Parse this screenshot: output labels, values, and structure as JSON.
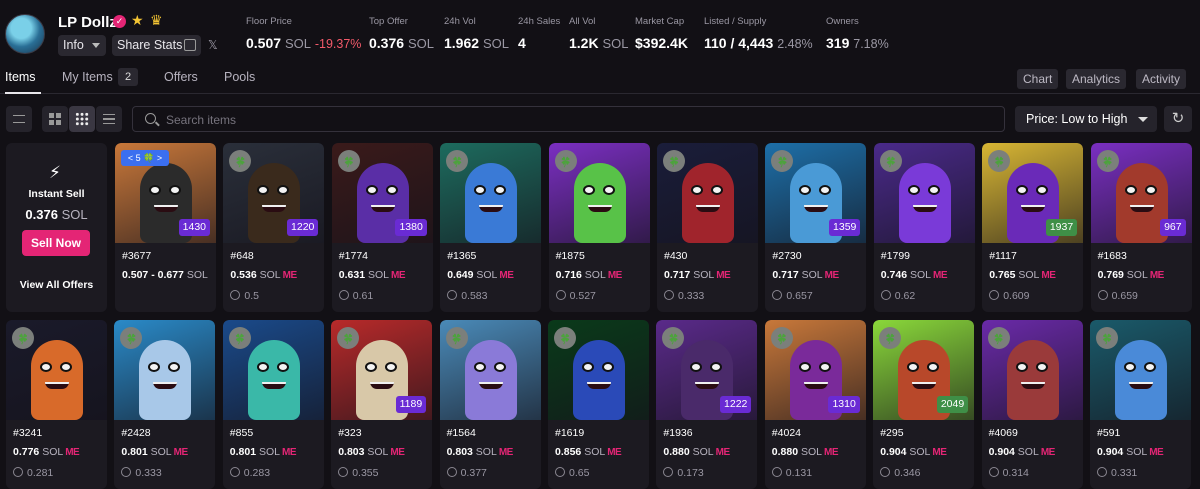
{
  "collection": {
    "name": "LP Dollz",
    "info_label": "Info",
    "share_label": "Share Stats",
    "x_label": "𝕏"
  },
  "stats": [
    {
      "label": "Floor Price",
      "value": "0.507",
      "unit": "SOL",
      "change": "-19.37%"
    },
    {
      "label": "Top Offer",
      "value": "0.376",
      "unit": "SOL"
    },
    {
      "label": "24h Vol",
      "value": "1.962",
      "unit": "SOL"
    },
    {
      "label": "24h Sales",
      "value": "4"
    },
    {
      "label": "All Vol",
      "value": "1.2K",
      "unit": "SOL"
    },
    {
      "label": "Market Cap",
      "value": "$392.4K"
    },
    {
      "label": "Listed / Supply",
      "value": "110 / 4,443",
      "pct": "2.48%"
    },
    {
      "label": "Owners",
      "value": "319",
      "pct": "7.18%"
    }
  ],
  "tabs": {
    "items": "Items",
    "my_items": "My Items",
    "my_items_count": "2",
    "offers": "Offers",
    "pools": "Pools",
    "chart": "Chart",
    "analytics": "Analytics",
    "activity": "Activity"
  },
  "search": {
    "placeholder": "Search items"
  },
  "sort": {
    "selected": "Price: Low to High"
  },
  "instant_sell": {
    "label": "Instant Sell",
    "value": "0.376",
    "unit": "SOL",
    "button": "Sell Now",
    "view_offers": "View All Offers"
  },
  "pager": "< 5 🍀 >",
  "marketplace_mark": "ME",
  "row1": [
    {
      "id": "#3677",
      "price": "0.507 - 0.677",
      "unit": "SOL",
      "last": "",
      "rank": "1430",
      "rank_color": "purple",
      "bg": "#c9783a",
      "body": "#2b2b2b"
    },
    {
      "id": "#648",
      "price": "0.536",
      "unit": "SOL",
      "last": "0.5",
      "rank": "1220",
      "rank_color": "purple",
      "bg": "#2a2f3a",
      "body": "#3a2a1c"
    },
    {
      "id": "#1774",
      "price": "0.631",
      "unit": "SOL",
      "last": "0.61",
      "rank": "1380",
      "rank_color": "purple",
      "bg": "#3a1a1a",
      "body": "#5a2ea6"
    },
    {
      "id": "#1365",
      "price": "0.649",
      "unit": "SOL",
      "last": "0.583",
      "rank": "",
      "rank_color": "",
      "bg": "#1d6b5e",
      "body": "#3a7ad6"
    },
    {
      "id": "#1875",
      "price": "0.716",
      "unit": "SOL",
      "last": "0.527",
      "rank": "",
      "rank_color": "",
      "bg": "#7b2fc2",
      "body": "#58c248"
    },
    {
      "id": "#430",
      "price": "0.717",
      "unit": "SOL",
      "last": "0.333",
      "rank": "",
      "rank_color": "",
      "bg": "#1a1d3a",
      "body": "#a0242c"
    },
    {
      "id": "#2730",
      "price": "0.717",
      "unit": "SOL",
      "last": "0.657",
      "rank": "1359",
      "rank_color": "purple",
      "bg": "#1d6fa8",
      "body": "#4a9ad6"
    },
    {
      "id": "#1799",
      "price": "0.746",
      "unit": "SOL",
      "last": "0.62",
      "rank": "",
      "rank_color": "",
      "bg": "#4a2a8a",
      "body": "#7a3ad8"
    },
    {
      "id": "#1117",
      "price": "0.765",
      "unit": "SOL",
      "last": "0.609",
      "rank": "1937",
      "rank_color": "green",
      "bg": "#d8b634",
      "body": "#6a2ab8"
    },
    {
      "id": "#1683",
      "price": "0.769",
      "unit": "SOL",
      "last": "0.659",
      "rank": "967",
      "rank_color": "purple",
      "bg": "#7a2fc2",
      "body": "#a23a2c"
    }
  ],
  "row2": [
    {
      "id": "#3241",
      "price": "0.776",
      "unit": "SOL",
      "last": "0.281",
      "rank": "",
      "rank_color": "",
      "bg": "#1a1a2a",
      "body": "#d86a2a"
    },
    {
      "id": "#2428",
      "price": "0.801",
      "unit": "SOL",
      "last": "0.333",
      "rank": "",
      "rank_color": "",
      "bg": "#2a8ac8",
      "body": "#a8c8e8"
    },
    {
      "id": "#855",
      "price": "0.801",
      "unit": "SOL",
      "last": "0.283",
      "rank": "",
      "rank_color": "",
      "bg": "#1a4a8a",
      "body": "#3ab8a8"
    },
    {
      "id": "#323",
      "price": "0.803",
      "unit": "SOL",
      "last": "0.355",
      "rank": "1189",
      "rank_color": "purple",
      "bg": "#b82a2a",
      "body": "#d8c8a8"
    },
    {
      "id": "#1564",
      "price": "0.803",
      "unit": "SOL",
      "last": "0.377",
      "rank": "",
      "rank_color": "",
      "bg": "#4a8ab8",
      "body": "#8a7ad8"
    },
    {
      "id": "#1619",
      "price": "0.856",
      "unit": "SOL",
      "last": "0.65",
      "rank": "",
      "rank_color": "",
      "bg": "#0a3a1a",
      "body": "#2a4ab8"
    },
    {
      "id": "#1936",
      "price": "0.880",
      "unit": "SOL",
      "last": "0.173",
      "rank": "1222",
      "rank_color": "purple",
      "bg": "#5a2a8a",
      "body": "#4a2a6a"
    },
    {
      "id": "#4024",
      "price": "0.880",
      "unit": "SOL",
      "last": "0.131",
      "rank": "1310",
      "rank_color": "purple",
      "bg": "#c8783a",
      "body": "#7a2a9a"
    },
    {
      "id": "#295",
      "price": "0.904",
      "unit": "SOL",
      "last": "0.346",
      "rank": "2049",
      "rank_color": "green",
      "bg": "#8ad83a",
      "body": "#b8482a"
    },
    {
      "id": "#4069",
      "price": "0.904",
      "unit": "SOL",
      "last": "0.314",
      "rank": "",
      "rank_color": "",
      "bg": "#6a2aa8",
      "body": "#9a3a3a"
    },
    {
      "id": "#591",
      "price": "0.904",
      "unit": "SOL",
      "last": "0.331",
      "rank": "",
      "rank_color": "",
      "bg": "#1a5a6a",
      "body": "#4a8ad8"
    }
  ]
}
